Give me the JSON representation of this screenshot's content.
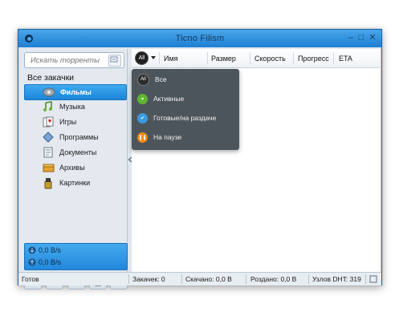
{
  "window": {
    "title": "Ticno Filism",
    "controls": {
      "minimize": "–",
      "maximize": "□",
      "close": "✕"
    }
  },
  "sidebar": {
    "search_placeholder": "Искать торренты",
    "section_title": "Все закачки",
    "categories": [
      {
        "label": "Фильмы",
        "icon": "film-reel-icon",
        "selected": true
      },
      {
        "label": "Музыка",
        "icon": "music-note-icon",
        "selected": false
      },
      {
        "label": "Игры",
        "icon": "playing-cards-icon",
        "selected": false
      },
      {
        "label": "Программы",
        "icon": "diamond-box-icon",
        "selected": false
      },
      {
        "label": "Документы",
        "icon": "document-icon",
        "selected": false
      },
      {
        "label": "Архивы",
        "icon": "archive-box-icon",
        "selected": false
      },
      {
        "label": "Картинки",
        "icon": "paint-bucket-icon",
        "selected": false
      }
    ],
    "speed": {
      "download": "0,0 B/s",
      "upload": "0,0 B/s"
    },
    "toolbar": [
      "settings-gear-icon",
      "plus-icon",
      "pause-icon",
      "trash-icon",
      "rss-icon"
    ]
  },
  "main": {
    "filter_button": "All",
    "columns": [
      "Имя",
      "Размер",
      "Скорость",
      "Прогресс",
      "ETA"
    ],
    "filter_menu": [
      {
        "label": "Все",
        "color": "#2b2b2b",
        "glyph": "All"
      },
      {
        "label": "Активные",
        "color": "#5db531",
        "glyph": "▾"
      },
      {
        "label": "Готовые/на раздаче",
        "color": "#3a9ae0",
        "glyph": "✔"
      },
      {
        "label": "На паузе",
        "color": "#f08a14",
        "glyph": "❚❚"
      }
    ]
  },
  "statusbar": {
    "state": "Готов",
    "downloads": "Закачек: 0",
    "downloaded": "Скачано: 0,0 B",
    "uploaded": "Роздано: 0,0 B",
    "dht": "Узлов DHT: 319"
  },
  "colors": {
    "accent": "#2a8fe0",
    "titlebar": "#3f9be6",
    "menu_bg": "#424a52"
  }
}
